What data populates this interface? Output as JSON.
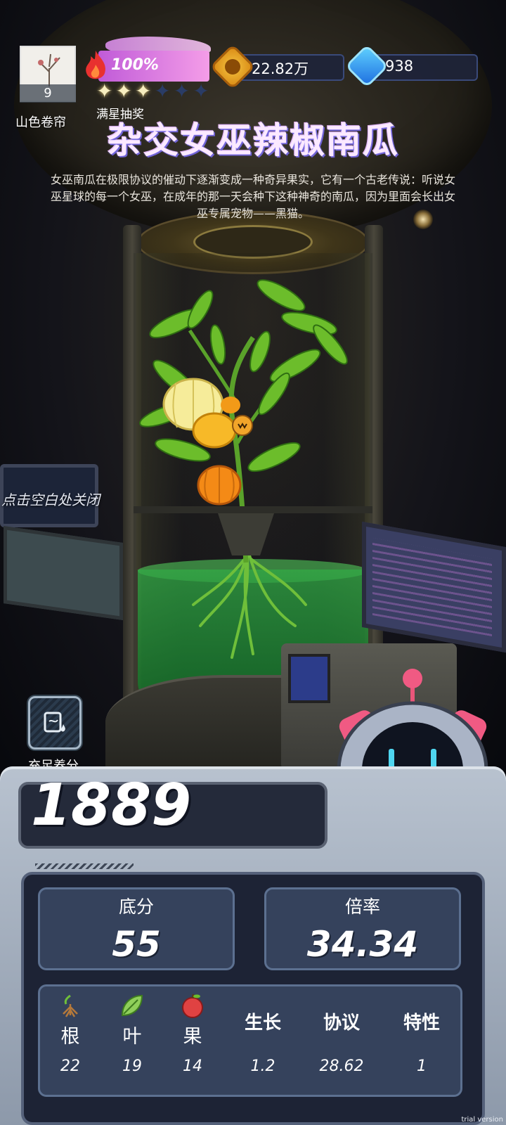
{
  "player": {
    "level": "9",
    "name": "山色卷帘"
  },
  "energy": {
    "percent_text": "100%",
    "stars_filled": 3,
    "stars_total": 6,
    "stars_label": "满星抽奖"
  },
  "currency": {
    "gold": "22.82万",
    "gems": "938"
  },
  "item": {
    "title": "杂交女巫辣椒南瓜",
    "description": "女巫南瓜在极限协议的催动下逐渐变成一种奇异果实，它有一个古老传说：听说女巫星球的每一个女巫，在成年的那一天会种下这种神奇的南瓜，因为里面会长出女巫专属宠物——黑猫。"
  },
  "hints": {
    "close": "点击空白处关闭",
    "nutrient": "充足养分"
  },
  "score": {
    "total": "1889",
    "base_label": "底分",
    "base_value": "55",
    "mult_label": "倍率",
    "mult_value": "34.34"
  },
  "attributes": [
    {
      "label": "根",
      "value": "22",
      "icon": "root-icon"
    },
    {
      "label": "叶",
      "value": "19",
      "icon": "leaf-icon"
    },
    {
      "label": "果",
      "value": "14",
      "icon": "apple-icon"
    },
    {
      "label": "生长",
      "value": "1.2"
    },
    {
      "label": "协议",
      "value": "28.62"
    },
    {
      "label": "特性",
      "value": "1"
    }
  ],
  "watermark": "trial version",
  "colors": {
    "energy_bar": "#d77be6",
    "star_on": "#f7eec0",
    "panel_bg": "#1d2335",
    "card_bg": "#35425c",
    "liquid": "#2f9a46"
  }
}
